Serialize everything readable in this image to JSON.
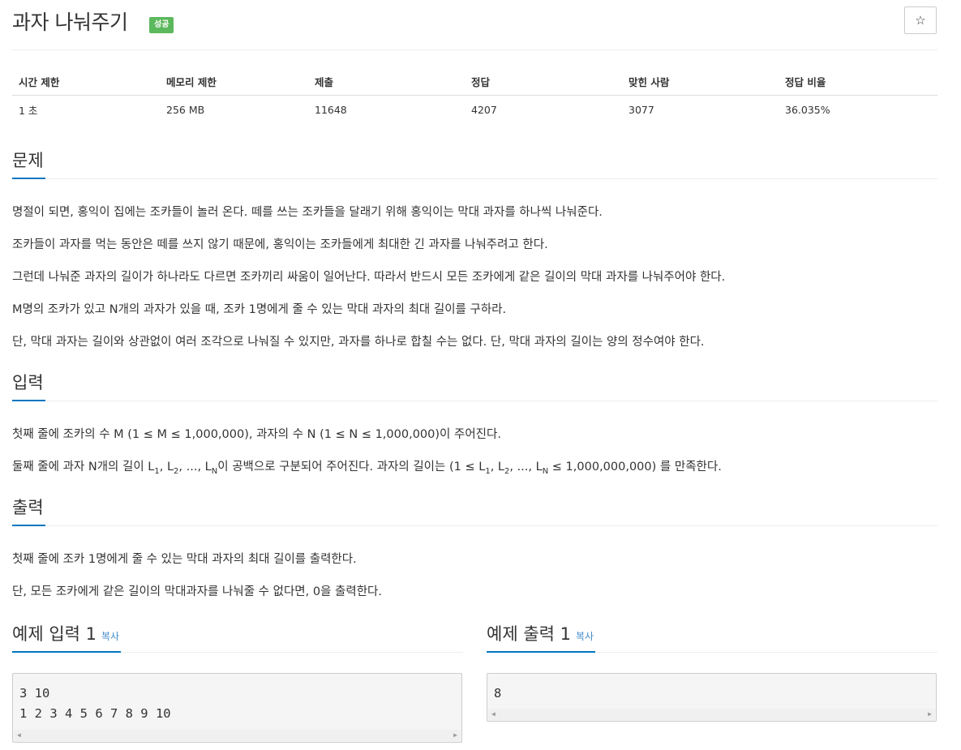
{
  "problem": {
    "title": "과자 나눠주기",
    "status_badge": "성공",
    "star_icon": "☆"
  },
  "stats": {
    "headers": [
      "시간 제한",
      "메모리 제한",
      "제출",
      "정답",
      "맞힌 사람",
      "정답 비율"
    ],
    "values": [
      "1 초",
      "256 MB",
      "11648",
      "4207",
      "3077",
      "36.035%"
    ]
  },
  "description": {
    "heading": "문제",
    "paragraphs": [
      "명절이 되면, 홍익이 집에는 조카들이 놀러 온다. 떼를 쓰는 조카들을 달래기 위해 홍익이는 막대 과자를 하나씩 나눠준다.",
      "조카들이 과자를 먹는 동안은 떼를 쓰지 않기 때문에, 홍익이는 조카들에게 최대한 긴 과자를 나눠주려고 한다.",
      "그런데 나눠준 과자의 길이가 하나라도 다르면 조카끼리 싸움이 일어난다. 따라서 반드시 모든 조카에게 같은 길이의 막대 과자를 나눠주어야 한다.",
      "M명의 조카가 있고 N개의 과자가 있을 때, 조카 1명에게 줄 수 있는 막대 과자의 최대 길이를 구하라.",
      "단, 막대 과자는 길이와 상관없이 여러 조각으로 나눠질 수 있지만, 과자를 하나로 합칠 수는 없다. 단, 막대 과자의 길이는 양의 정수여야 한다."
    ]
  },
  "input": {
    "heading": "입력",
    "line1": "첫째 줄에 조카의 수 M (1 ≤ M ≤ 1,000,000), 과자의 수 N (1 ≤ N ≤ 1,000,000)이 주어진다.",
    "line2": {
      "prefix": "둘째 줄에 과자 N개의 길이 L",
      "sub1": "1",
      "mid1": ", L",
      "sub2": "2",
      "mid2": ", ..., L",
      "subN": "N",
      "mid3": "이 공백으로 구분되어 주어진다. 과자의 길이는 (1 ≤ L",
      "sub1b": "1",
      "mid4": ", L",
      "sub2b": "2",
      "mid5": ", ..., L",
      "subNb": "N",
      "suffix": " ≤ 1,000,000,000) 를 만족한다."
    }
  },
  "output": {
    "heading": "출력",
    "paragraphs": [
      "첫째 줄에 조카 1명에게 줄 수 있는 막대 과자의 최대 길이를 출력한다.",
      "단, 모든 조카에게 같은 길이의 막대과자를 나눠줄 수 없다면, 0을 출력한다."
    ]
  },
  "sample_input": {
    "heading": "예제 입력 1",
    "copy_label": "복사",
    "content": "3 10\n1 2 3 4 5 6 7 8 9 10"
  },
  "sample_output": {
    "heading": "예제 출력 1",
    "copy_label": "복사",
    "content": "8"
  },
  "colors": {
    "badge_green": "#5cb85c",
    "heading_underline": "#0076c0",
    "link_blue": "#428bca"
  }
}
